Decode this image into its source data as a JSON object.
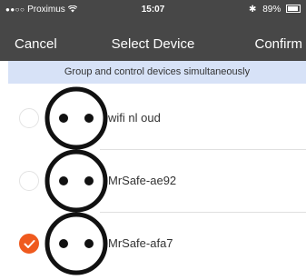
{
  "status_bar": {
    "carrier": "Proximus",
    "time": "15:07",
    "battery": "89%"
  },
  "navbar": {
    "cancel_label": "Cancel",
    "title": "Select Device",
    "confirm_label": "Confirm"
  },
  "banner": {
    "text": "Group and control devices simultaneously"
  },
  "devices": [
    {
      "name": "wifi nl oud",
      "selected": false
    },
    {
      "name": "MrSafe-ae92",
      "selected": false
    },
    {
      "name": "MrSafe-afa7",
      "selected": true
    }
  ],
  "colors": {
    "bar_bg": "#474747",
    "banner_bg": "#d7e2f7",
    "accent": "#ef5a1e"
  },
  "icons": {
    "device": "power-socket-icon",
    "selected": "checkmark-icon"
  }
}
